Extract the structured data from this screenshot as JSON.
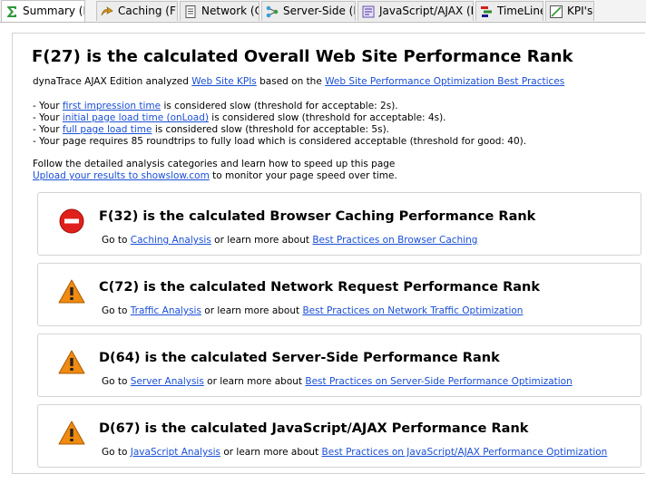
{
  "tabs": [
    {
      "label": "Summary (F)",
      "icon": "sigma-icon",
      "active": true
    },
    {
      "label": "Caching (F)",
      "icon": "caching-icon",
      "active": false
    },
    {
      "label": "Network (C)",
      "icon": "document-icon",
      "active": false
    },
    {
      "label": "Server-Side (D)",
      "icon": "server-nodes-icon",
      "active": false
    },
    {
      "label": "JavaScript/AJAX (D)",
      "icon": "javascript-icon",
      "active": false
    },
    {
      "label": "TimeLine",
      "icon": "timeline-icon",
      "active": false
    },
    {
      "label": "KPI's",
      "icon": "kpi-chart-icon",
      "active": false
    }
  ],
  "summary": {
    "title": "F(27) is the calculated Overall Web Site Performance Rank",
    "intro": {
      "prefix": "dynaTrace AJAX Edition analyzed ",
      "link1": "Web Site KPIs",
      "middle": " based on the ",
      "link2": "Web Site Performance Optimization Best Practices"
    },
    "details": [
      {
        "prefix": "- Your ",
        "link": "first impression time",
        "suffix": " is considered slow (threshold for acceptable: 2s)."
      },
      {
        "prefix": "- Your ",
        "link": "initial page load time (onLoad)",
        "suffix": " is considered slow (threshold for acceptable: 4s)."
      },
      {
        "prefix": "- Your ",
        "link": "full page load time",
        "suffix": " is considered slow (threshold for acceptable: 5s)."
      },
      {
        "prefix": "- Your page requires 85 roundtrips to fully load which is considered acceptable (threshold for good: 40).",
        "link": "",
        "suffix": ""
      }
    ],
    "follow_text": "Follow the detailed analysis categories and learn how to speed up this page",
    "upload_link": "Upload your results to showslow.com",
    "upload_suffix": " to monitor your page speed over time."
  },
  "categories": [
    {
      "icon": "error-stop-icon",
      "status_color": "#e0201b",
      "title": "F(32) is the calculated Browser Caching Performance Rank",
      "goto": "Go to ",
      "analysis_link": "Caching Analysis",
      "middle": " or learn more about ",
      "practices_link": "Best Practices on Browser Caching"
    },
    {
      "icon": "warning-icon",
      "status_color": "#f08a10",
      "title": "C(72) is the calculated Network Request Performance Rank",
      "goto": "Go to ",
      "analysis_link": "Traffic Analysis",
      "middle": " or learn more about ",
      "practices_link": "Best Practices on Network Traffic Optimization"
    },
    {
      "icon": "warning-icon",
      "status_color": "#f08a10",
      "title": "D(64) is the calculated Server-Side Performance Rank",
      "goto": "Go to ",
      "analysis_link": "Server Analysis",
      "middle": " or learn more about ",
      "practices_link": "Best Practices on Server-Side Performance Optimization"
    },
    {
      "icon": "warning-icon",
      "status_color": "#f08a10",
      "title": "D(67) is the calculated JavaScript/AJAX Performance Rank",
      "goto": "Go to ",
      "analysis_link": "JavaScript Analysis",
      "middle": " or learn more about ",
      "practices_link": "Best Practices on JavaScript/AJAX Performance Optimization"
    }
  ],
  "colors": {
    "link": "#1a4fd6",
    "error": "#e0201b",
    "warning": "#f08a10"
  }
}
